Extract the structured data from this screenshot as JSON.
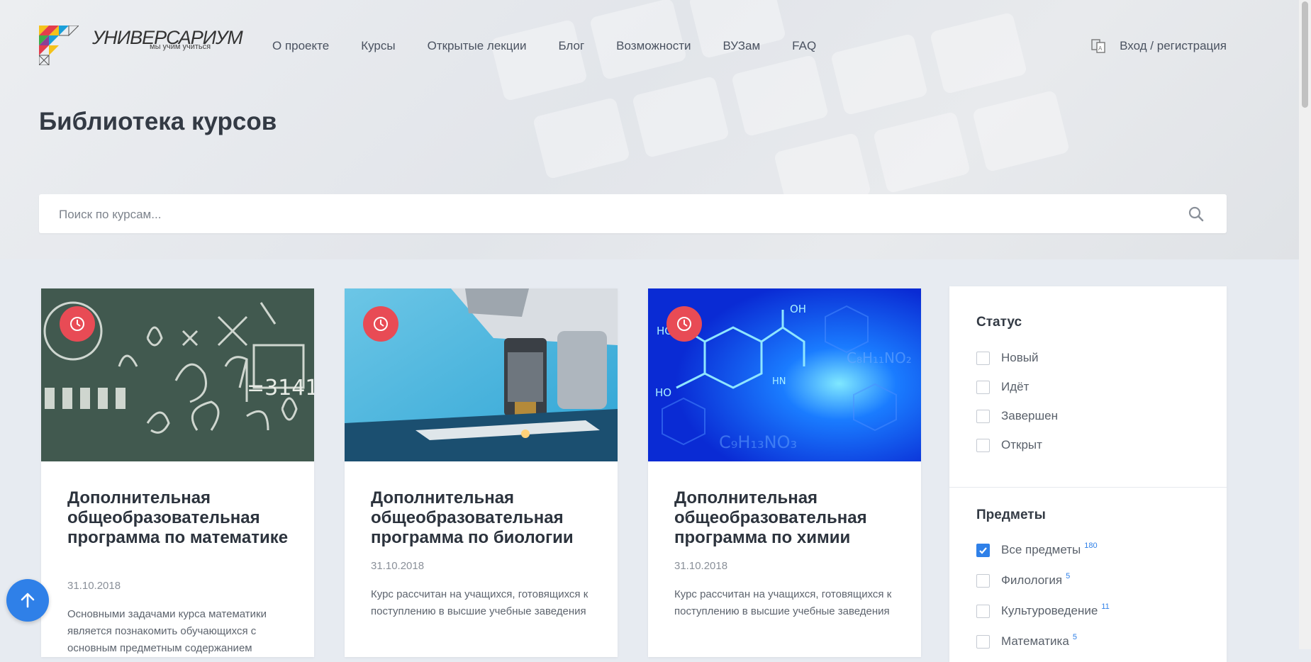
{
  "logo": {
    "name": "УНИВЕРСАРИУМ",
    "tagline": "мы учим учиться"
  },
  "nav": {
    "items": [
      {
        "label": "О проекте"
      },
      {
        "label": "Курсы"
      },
      {
        "label": "Открытые лекции"
      },
      {
        "label": "Блог"
      },
      {
        "label": "Возможности"
      },
      {
        "label": "ВУЗам"
      },
      {
        "label": "FAQ"
      }
    ],
    "login_label": "Вход / регистрация"
  },
  "page": {
    "title": "Библиотека курсов"
  },
  "search": {
    "placeholder": "Поиск по курсам...",
    "value": ""
  },
  "courses": [
    {
      "title": "Дополнительная общеобразовательная программа по математике",
      "date": "31.10.2018",
      "description": "Основными задачами курса математики является познакомить обучающихся с основным предметным содержанием"
    },
    {
      "title": "Дополнительная общеобразовательная программа по биологии",
      "date": "31.10.2018",
      "description": "Курс рассчитан на учащихся, готовящихся к поступлению в высшие учебные заведения"
    },
    {
      "title": "Дополнительная общеобразовательная программа по химии",
      "date": "31.10.2018",
      "description": "Курс рассчитан на учащихся, готовящихся к поступлению в высшие учебные заведения"
    }
  ],
  "filters": {
    "status": {
      "title": "Статус",
      "options": [
        {
          "label": "Новый",
          "checked": false
        },
        {
          "label": "Идёт",
          "checked": false
        },
        {
          "label": "Завершен",
          "checked": false
        },
        {
          "label": "Открыт",
          "checked": false
        }
      ]
    },
    "subjects": {
      "title": "Предметы",
      "options": [
        {
          "label": "Все предметы",
          "count": "180",
          "checked": true
        },
        {
          "label": "Филология",
          "count": "5",
          "checked": false
        },
        {
          "label": "Культуроведение",
          "count": "11",
          "checked": false
        },
        {
          "label": "Математика",
          "count": "5",
          "checked": false
        }
      ]
    }
  },
  "colors": {
    "accent": "#2f80e8",
    "badge": "#e84b55"
  },
  "icons": {
    "search": "search-icon",
    "scroll_top": "arrow-up-icon",
    "login": "translate-icon",
    "course_badge": "clock-icon"
  }
}
